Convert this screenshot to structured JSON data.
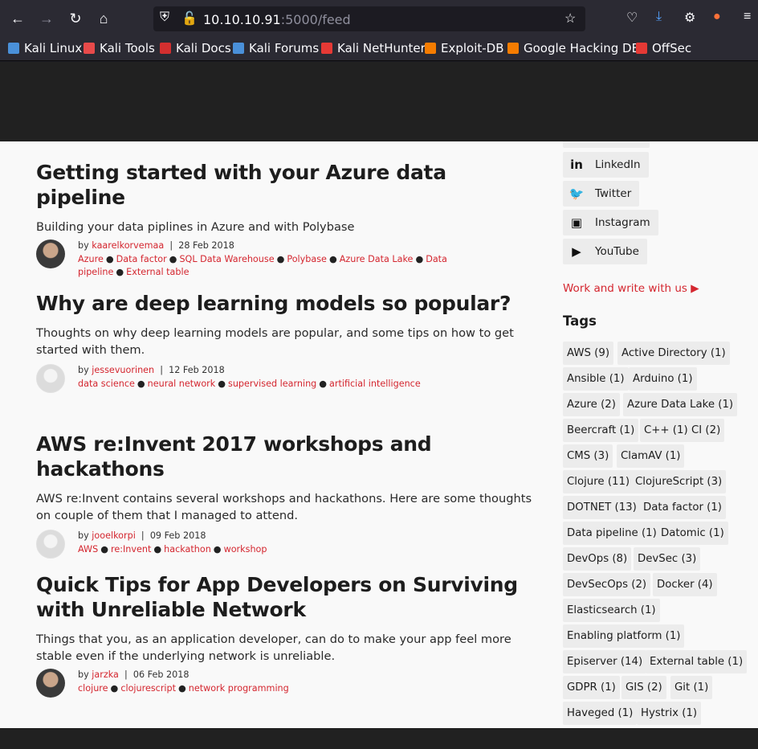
{
  "browser": {
    "url_host": "10.10.10.91",
    "url_path": ":5000/feed",
    "bookmarks": [
      {
        "label": "Kali Linux",
        "color": "#4a90d9"
      },
      {
        "label": "Kali Tools",
        "color": "#e84a4a"
      },
      {
        "label": "Kali Docs",
        "color": "#d32f2f"
      },
      {
        "label": "Kali Forums",
        "color": "#4a90d9"
      },
      {
        "label": "Kali NetHunter",
        "color": "#e53935"
      },
      {
        "label": "Exploit-DB",
        "color": "#f57c00"
      },
      {
        "label": "Google Hacking DB",
        "color": "#f57c00"
      },
      {
        "label": "OffSec",
        "color": "#e53935"
      }
    ]
  },
  "posts": [
    {
      "title": "Getting started with your Azure data pipeline",
      "description": "Building your data piplines in Azure and with Polybase",
      "author": "kaarelkorvemaa",
      "date": "28 Feb 2018",
      "tags": [
        "Azure",
        "Data factor",
        "SQL Data Warehouse",
        "Polybase",
        "Azure Data Lake",
        "Data pipeline",
        "External table"
      ]
    },
    {
      "title": "Why are deep learning models so popular?",
      "description": "Thoughts on why deep learning models are popular, and some tips on how to get started with them.",
      "author": "jessevuorinen",
      "date": "12 Feb 2018",
      "tags": [
        "data science",
        "neural network",
        "supervised learning",
        "artificial intelligence"
      ]
    },
    {
      "title": "AWS re:Invent 2017 workshops and hackathons",
      "description": "AWS re:Invent contains several workshops and hackathons. Here are some thoughts on couple of them that I managed to attend.",
      "author": "jooelkorpi",
      "date": "09 Feb 2018",
      "tags": [
        "AWS",
        "re:Invent",
        "hackathon",
        "workshop"
      ]
    },
    {
      "title": "Quick Tips for App Developers on Surviving with Unreliable Network",
      "description": "Things that you, as an application developer, can do to make your app feel more stable even if the underlying network is unreliable.",
      "author": "jarzka",
      "date": "06 Feb 2018",
      "tags": [
        "clojure",
        "clojurescript",
        "network programming"
      ]
    }
  ],
  "sidebar": {
    "social": [
      {
        "label": "LinkedIn",
        "icon": "linkedin-icon"
      },
      {
        "label": "Twitter",
        "icon": "twitter-icon"
      },
      {
        "label": "Instagram",
        "icon": "instagram-icon"
      },
      {
        "label": "YouTube",
        "icon": "youtube-icon"
      }
    ],
    "work_link": "Work and write with us",
    "tags_title": "Tags",
    "tags": [
      "AWS (9)",
      "Active Directory (1)",
      "Ansible (1)",
      "Arduino (1)",
      "Azure (2)",
      "Azure Data Lake (1)",
      "Beercraft (1)",
      "C++ (1)",
      "CI (2)",
      "CMS (3)",
      "ClamAV (1)",
      "Clojure (11)",
      "ClojureScript (3)",
      "DOTNET (13)",
      "Data factor (1)",
      "Data pipeline (1)",
      "Datomic (1)",
      "DevOps (8)",
      "DevSec (3)",
      "DevSecOps (2)",
      "Docker (4)",
      "Elasticsearch (1)",
      "Enabling platform (1)",
      "Episerver (14)",
      "External table (1)",
      "GDPR (1)",
      "GIS (2)",
      "Git (1)",
      "Haveged (1)",
      "Hystrix (1)"
    ],
    "accent_color": "#d4262f"
  }
}
